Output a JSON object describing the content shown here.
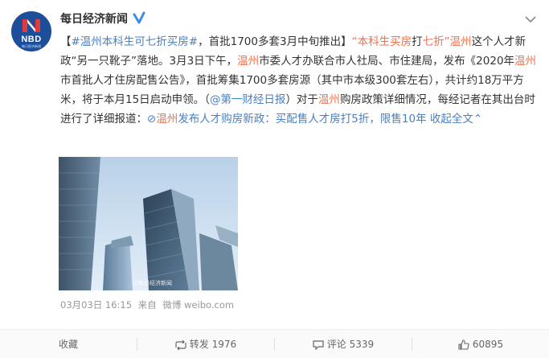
{
  "header": {
    "username": "每日经济新闻",
    "avatar_text": "NBD",
    "avatar_subtext": "每日经济新闻",
    "verified_icon": "verified-badge-icon",
    "menu_icon": "chevron-down-icon"
  },
  "post": {
    "segments": [
      {
        "t": "【",
        "c": "cn"
      },
      {
        "t": "#温州本科生可七折买房#",
        "c": "link"
      },
      {
        "t": "，首批1700多套3月中旬推出】",
        "c": "cn"
      },
      {
        "t": "“本科生买房",
        "c": "hl"
      },
      {
        "t": "打",
        "c": "cn"
      },
      {
        "t": "七折",
        "c": "hl"
      },
      {
        "t": "”",
        "c": "hl"
      },
      {
        "t": "温州",
        "c": "hl"
      },
      {
        "t": "这个人才新政“另一只靴子”落地。3月3日下午，",
        "c": "cn"
      },
      {
        "t": "温州",
        "c": "hl"
      },
      {
        "t": "市委人才办联合市人社局、市住建局，发布《2020年",
        "c": "cn"
      },
      {
        "t": "温州",
        "c": "hl"
      },
      {
        "t": "市首批人才住房配售公告》，首批筹集1700多套房源（其中市本级300套左右），共计约18万平方米，将于本月15日启动申领。（",
        "c": "cn"
      },
      {
        "t": "@第一财经日报",
        "c": "link"
      },
      {
        "t": "）对于",
        "c": "cn"
      },
      {
        "t": "温州",
        "c": "hl"
      },
      {
        "t": "购房政策详细情况，每经记者在其出台时进行了详细报道：",
        "c": "cn"
      },
      {
        "t": "⊘",
        "c": "link"
      },
      {
        "t": "温州",
        "c": "hl"
      },
      {
        "t": "发布人才购房新政：买配售人才房打5折，限售10年",
        "c": "link"
      },
      {
        "t": " 收起全文",
        "c": "link"
      },
      {
        "t": "⌃",
        "c": "link"
      }
    ],
    "image_watermark": "@每日经济新闻"
  },
  "meta": {
    "date": "03月03日 16:15",
    "source_prefix": "来自",
    "source": "微博 weibo.com"
  },
  "actions": {
    "favorite": "收藏",
    "repost_label": "转发",
    "repost_count": "1976",
    "comment_label": "评论",
    "comment_count": "5339",
    "like_count": "60895"
  },
  "colors": {
    "highlight": "#eb7350",
    "link": "#4a7fc1",
    "brand_blue": "#1d4e9a"
  }
}
